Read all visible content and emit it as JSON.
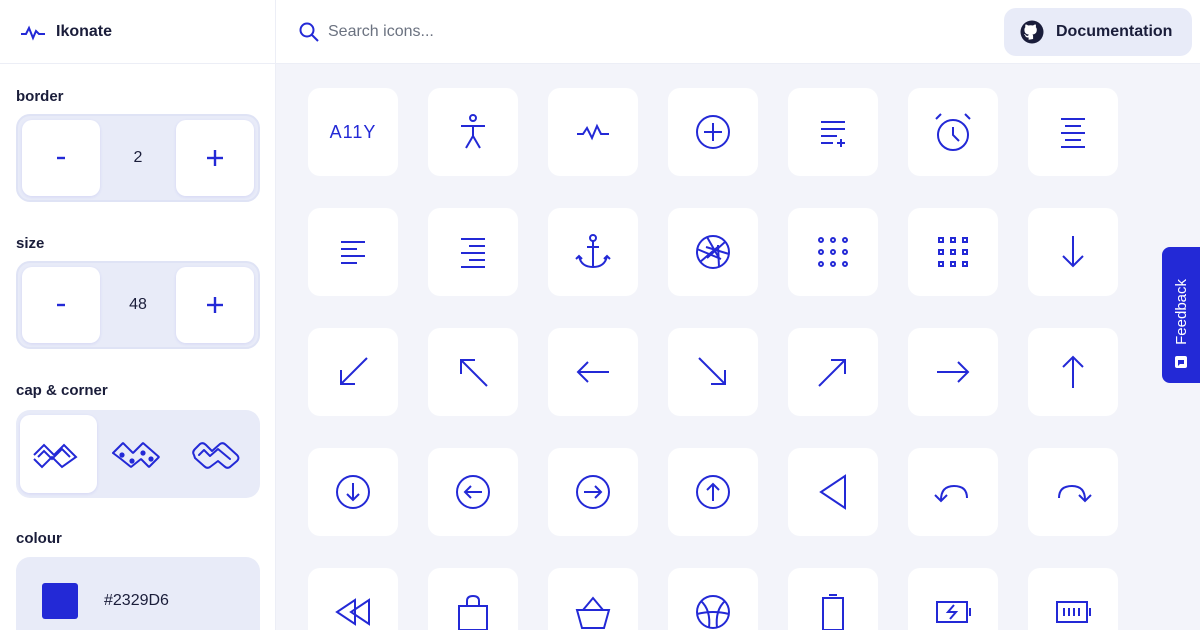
{
  "app": {
    "name": "Ikonate"
  },
  "search": {
    "placeholder": "Search icons..."
  },
  "header": {
    "documentation_label": "Documentation"
  },
  "controls": {
    "border": {
      "label": "border",
      "value": "2",
      "minus": "-",
      "plus": "+"
    },
    "size": {
      "label": "size",
      "value": "48",
      "minus": "-",
      "plus": "+"
    },
    "cap_corner": {
      "label": "cap & corner",
      "options": [
        "square-miter",
        "round-bevel",
        "round-round"
      ],
      "selected": 0
    },
    "colour": {
      "label": "colour",
      "value": "#2329D6"
    }
  },
  "icons": {
    "row1": [
      "a11y",
      "accessibility",
      "activity",
      "add",
      "add-to-list",
      "alarm",
      "align-center"
    ],
    "row2": [
      "align-left",
      "align-right",
      "anchor",
      "aperture",
      "apps",
      "apps-alt",
      "arrow-down"
    ],
    "row3": [
      "arrow-down-left",
      "arrow-up-left",
      "arrow-left",
      "arrow-down-right",
      "arrow-up-right",
      "arrow-right",
      "arrow-up"
    ],
    "row4": [
      "arrow-down-circle",
      "arrow-left-circle",
      "arrow-right-circle",
      "arrow-up-circle",
      "back",
      "back-alt",
      "forward"
    ],
    "row5": [
      "rewind",
      "bag",
      "basket",
      "basketball",
      "battery",
      "battery-charging",
      "battery-full"
    ],
    "a11y_text": "A11Y"
  },
  "feedback": {
    "label": "Feedback"
  },
  "colors": {
    "accent": "#2329D6",
    "panel": "#e8ebf8",
    "canvas": "#f3f4fa"
  }
}
